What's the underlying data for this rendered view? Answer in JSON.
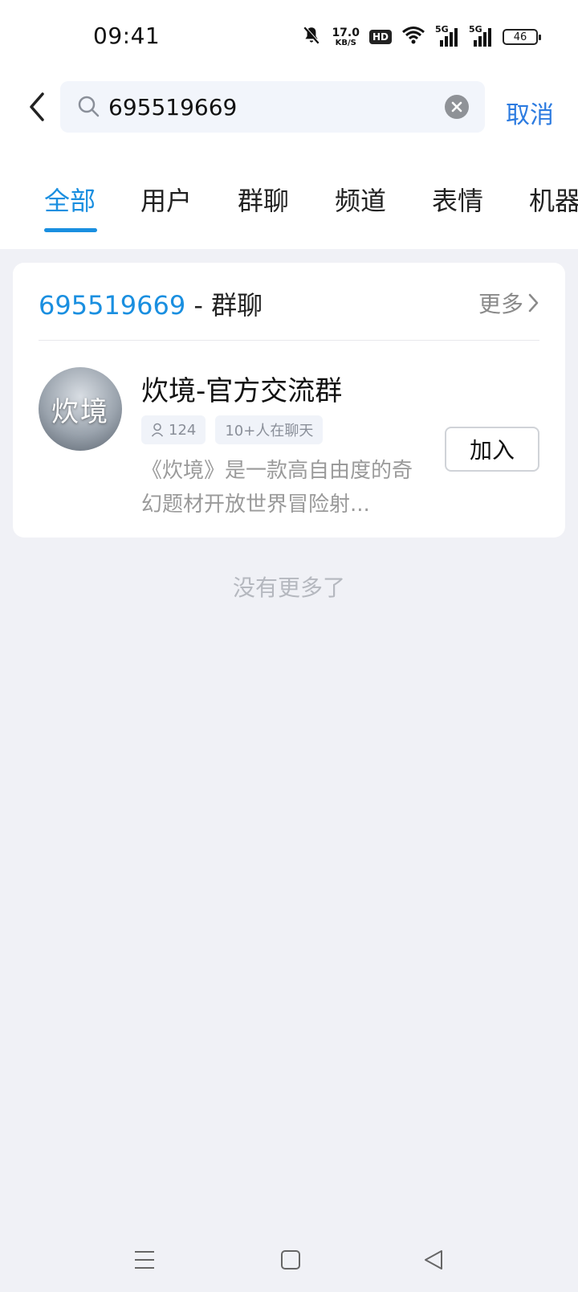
{
  "status_bar": {
    "time": "09:41",
    "net_speed_value": "17.0",
    "net_speed_unit": "KB/S",
    "hd_label": "HD",
    "signal_1_label": "5G",
    "signal_2_label": "5G",
    "battery_level": "46"
  },
  "search": {
    "query": "695519669",
    "cancel_label": "取消"
  },
  "tabs": [
    {
      "label": "全部",
      "active": true
    },
    {
      "label": "用户",
      "active": false
    },
    {
      "label": "群聊",
      "active": false
    },
    {
      "label": "频道",
      "active": false
    },
    {
      "label": "表情",
      "active": false
    },
    {
      "label": "机器",
      "active": false
    }
  ],
  "result_card": {
    "query_text": "695519669",
    "separator": " - ",
    "section_label": "群聊",
    "more_label": "更多",
    "group": {
      "avatar_text": "炊境",
      "name": "炊境-官方交流群",
      "member_count": "124",
      "activity_tag": "10+人在聊天",
      "description": "《炊境》是一款高自由度的奇幻题材开放世界冒险射...",
      "join_label": "加入"
    }
  },
  "no_more_text": "没有更多了",
  "colors": {
    "accent": "#1a8fe0",
    "cancel": "#2c7be0",
    "background": "#f0f1f6"
  }
}
